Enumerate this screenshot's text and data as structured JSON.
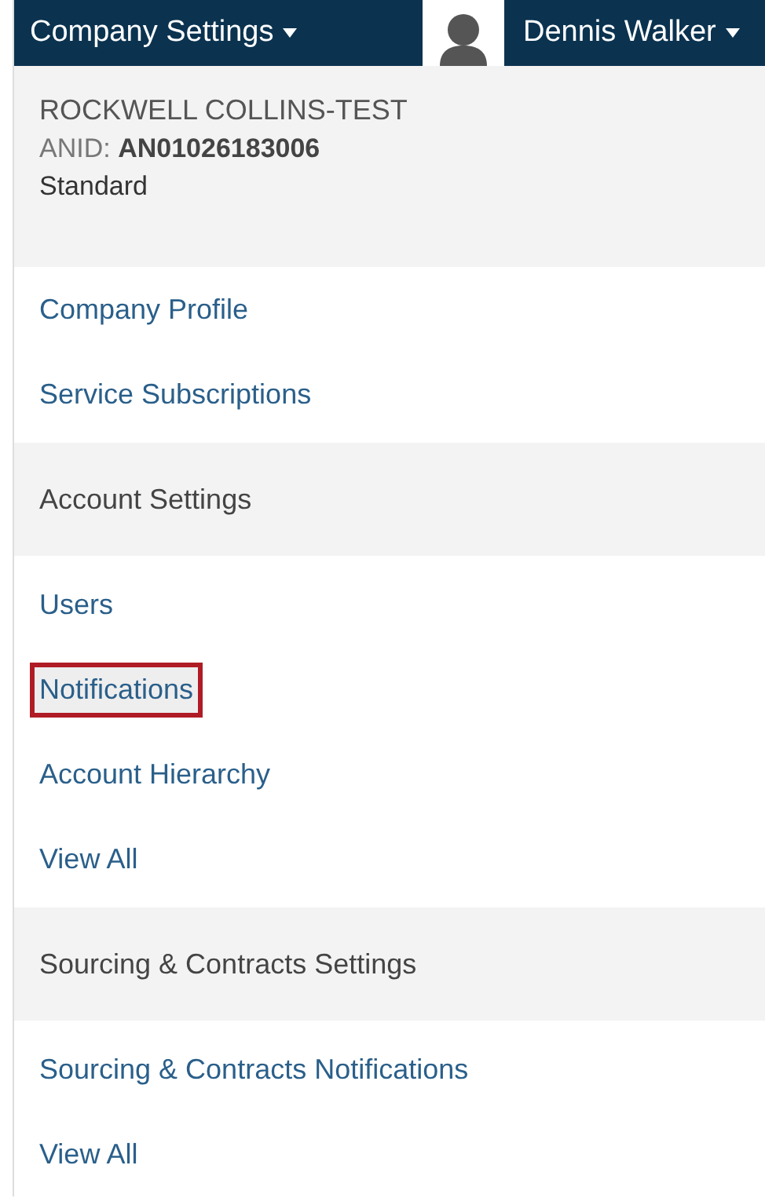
{
  "topbar": {
    "menu": "Company Settings",
    "user": "Dennis Walker"
  },
  "account": {
    "company": "ROCKWELL COLLINS-TEST",
    "anid_label": "ANID:",
    "anid": "AN01026183006",
    "plan": "Standard"
  },
  "items": [
    {
      "kind": "link",
      "label": "Company Profile",
      "highlighted": false
    },
    {
      "kind": "link",
      "label": "Service Subscriptions",
      "highlighted": false
    },
    {
      "kind": "header",
      "label": "Account Settings"
    },
    {
      "kind": "link",
      "label": "Users",
      "highlighted": false
    },
    {
      "kind": "link",
      "label": "Notifications",
      "highlighted": true
    },
    {
      "kind": "link",
      "label": "Account Hierarchy",
      "highlighted": false
    },
    {
      "kind": "link",
      "label": "View All",
      "highlighted": false
    },
    {
      "kind": "header",
      "label": "Sourcing & Contracts Settings"
    },
    {
      "kind": "link",
      "label": "Sourcing & Contracts Notifications",
      "highlighted": false
    },
    {
      "kind": "link",
      "label": "View All",
      "highlighted": false
    }
  ]
}
